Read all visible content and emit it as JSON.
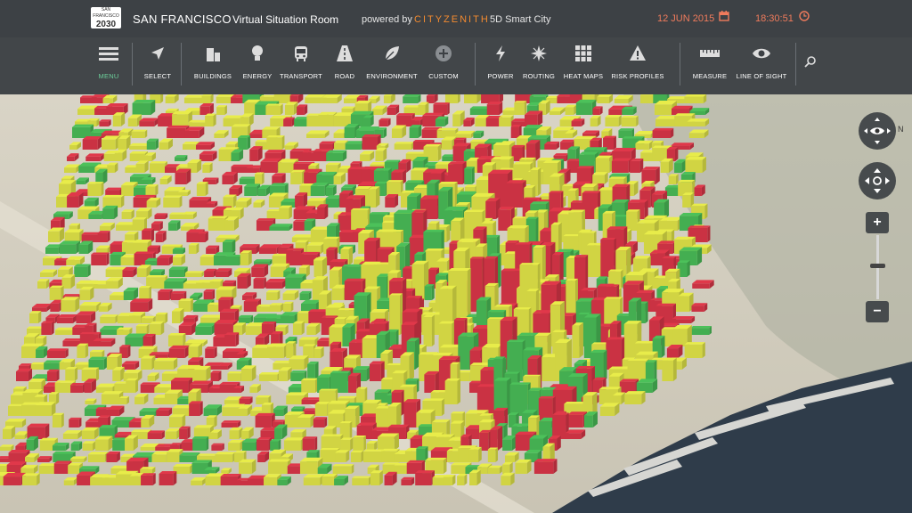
{
  "header": {
    "logo_top": "SAN FRANCISCO",
    "logo_year": "2030",
    "city": "SAN FRANCISCO",
    "room": "Virtual Situation Room",
    "powered": "powered by",
    "brand": "CITYZENITH",
    "brand_sub": "5D Smart City",
    "date": "12 JUN 2015",
    "time": "18:30:51"
  },
  "toolbar": {
    "menu": "MENU",
    "select": "SELECT",
    "buildings": "BUILDINGS",
    "energy": "ENERGY",
    "transport": "TRANSPORT",
    "road": "ROAD",
    "environment": "ENVIRONMENT",
    "custom": "CUSTOM",
    "power": "POWER",
    "routing": "ROUTING",
    "heat_maps": "HEAT MAPS",
    "risk_profiles": "RISK PROFILES",
    "measure": "MEASURE",
    "line_of_sight": "LINE OF SIGHT"
  },
  "map_controls": {
    "zoom_in": "+",
    "zoom_out": "−"
  },
  "colors": {
    "accent": "#f28a30",
    "alert": "#f07b5c",
    "active": "#6ccf9a",
    "building_yellow": "#e8ec4a",
    "building_red": "#e0384a",
    "building_green": "#4cc15a"
  }
}
